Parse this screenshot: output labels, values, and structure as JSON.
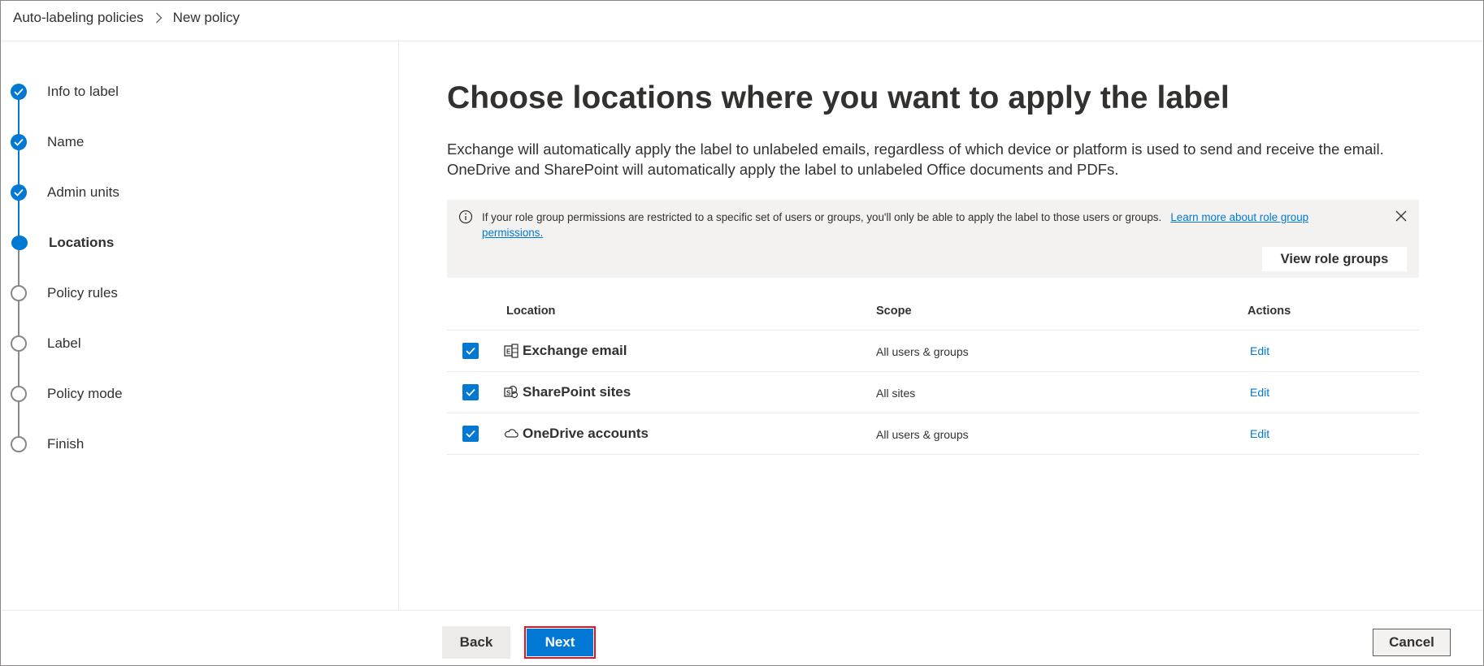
{
  "breadcrumb": {
    "parent": "Auto-labeling policies",
    "current": "New policy"
  },
  "steps": [
    {
      "label": "Info to label",
      "status": "done"
    },
    {
      "label": "Name",
      "status": "done"
    },
    {
      "label": "Admin units",
      "status": "done"
    },
    {
      "label": "Locations",
      "status": "current"
    },
    {
      "label": "Policy rules",
      "status": "todo"
    },
    {
      "label": "Label",
      "status": "todo"
    },
    {
      "label": "Policy mode",
      "status": "todo"
    },
    {
      "label": "Finish",
      "status": "todo"
    }
  ],
  "main": {
    "title": "Choose locations where you want to apply the label",
    "description_line1": "Exchange will automatically apply the label to unlabeled emails, regardless of which device or platform is used to send and receive the email.",
    "description_line2": "OneDrive and SharePoint will automatically apply the label to unlabeled Office documents and PDFs."
  },
  "info_bar": {
    "message": "If your role group permissions are restricted to a specific set of users or groups, you'll only be able to apply the label to those users or groups.",
    "link_text": "Learn more about role group permissions.",
    "button_label": "View role groups",
    "icon": "info-icon"
  },
  "table": {
    "headers": {
      "location": "Location",
      "scope": "Scope",
      "actions": "Actions"
    },
    "rows": [
      {
        "location": "Exchange email",
        "scope": "All users & groups",
        "action": "Edit",
        "checked": true,
        "icon": "exchange-icon"
      },
      {
        "location": "SharePoint sites",
        "scope": "All sites",
        "action": "Edit",
        "checked": true,
        "icon": "sharepoint-icon"
      },
      {
        "location": "OneDrive accounts",
        "scope": "All users & groups",
        "action": "Edit",
        "checked": true,
        "icon": "onedrive-icon"
      }
    ]
  },
  "footer": {
    "back_label": "Back",
    "next_label": "Next",
    "cancel_label": "Cancel"
  },
  "colors": {
    "accent": "#0078d4",
    "highlight_border": "#e81123",
    "info_bar_bg": "#f3f2f1"
  }
}
